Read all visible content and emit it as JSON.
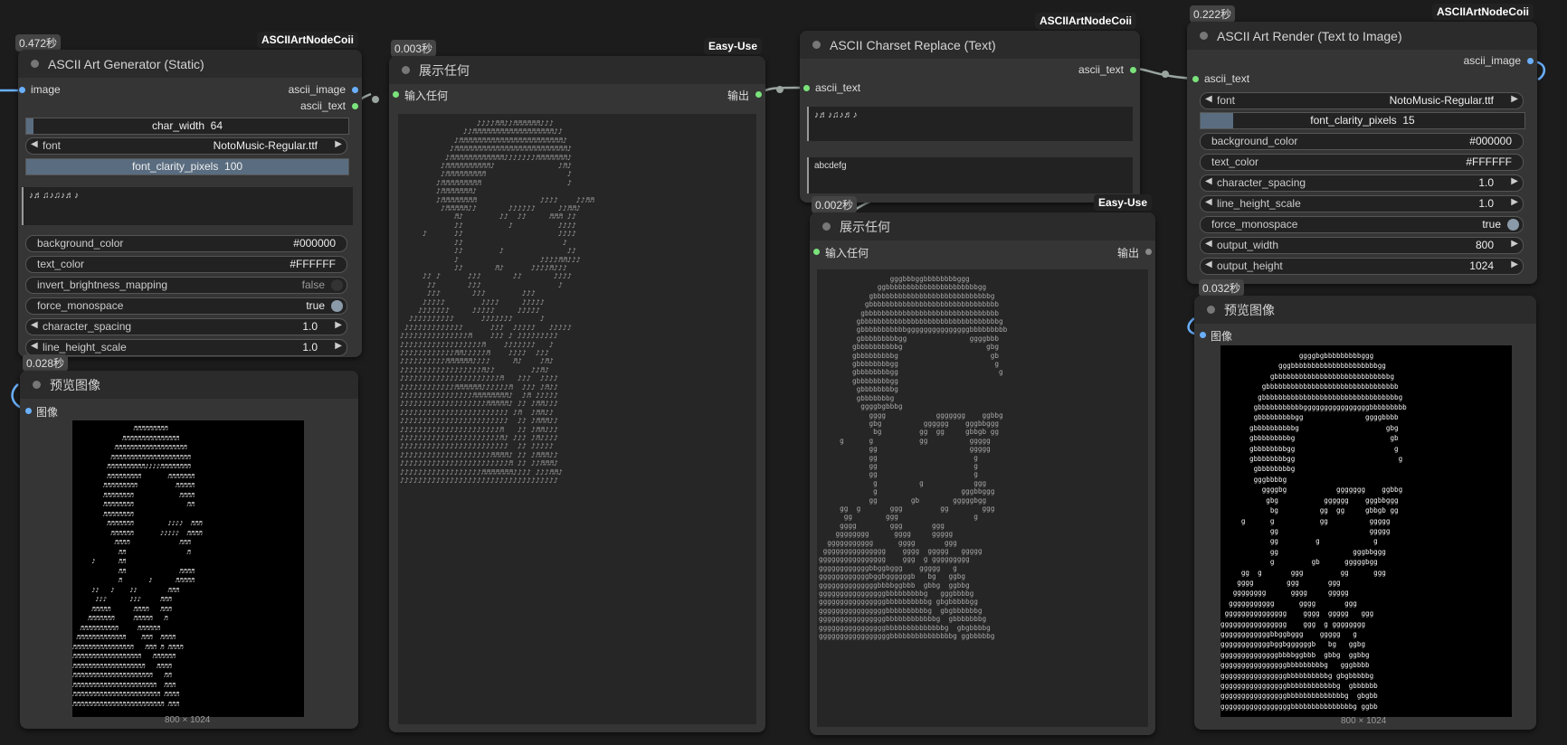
{
  "nodes": {
    "gen": {
      "time": "0.472秒",
      "badge": "ASCIIArtNodeCoii",
      "title": "ASCII Art Generator (Static)",
      "in_image": "image",
      "out_image": "ascii_image",
      "out_text": "ascii_text",
      "char_width_label": "char_width",
      "char_width_value": "64",
      "font_label": "font",
      "font_value": "NotoMusic-Regular.ttf",
      "clarity_label": "font_clarity_pixels",
      "clarity_value": "100",
      "charset": "♪♬♫♪♫♪♬♪",
      "bg_label": "background_color",
      "bg_value": "#000000",
      "text_color_label": "text_color",
      "text_color_value": "#FFFFFF",
      "invert_label": "invert_brightness_mapping",
      "invert_value": "false",
      "mono_label": "force_monospace",
      "mono_value": "true",
      "spacing_label": "character_spacing",
      "spacing_value": "1.0",
      "lh_label": "line_height_scale",
      "lh_value": "1.0"
    },
    "preview1": {
      "time": "0.028秒",
      "title": "预览图像",
      "in_label": "图像",
      "dim": "800 × 1024"
    },
    "show1": {
      "time": "0.003秒",
      "badge": "Easy-Use",
      "title": "展示任何",
      "in_label": "输入任何",
      "out_label": "输出"
    },
    "replace": {
      "badge": "ASCIIArtNodeCoii",
      "title": "ASCII Charset Replace (Text)",
      "out_text": "ascii_text",
      "in_text": "ascii_text",
      "from_chars": "♪♬♪♫♪♬♪",
      "to_chars": "abcdefg"
    },
    "show2": {
      "time": "0.002秒",
      "badge": "Easy-Use",
      "title": "展示任何",
      "in_label": "输入任何",
      "out_label": "输出"
    },
    "render": {
      "time": "0.222秒",
      "badge": "ASCIIArtNodeCoii",
      "title": "ASCII Art Render (Text to Image)",
      "out_image": "ascii_image",
      "in_text": "ascii_text",
      "font_label": "font",
      "font_value": "NotoMusic-Regular.ttf",
      "clarity_label": "font_clarity_pixels",
      "clarity_value": "15",
      "bg_label": "background_color",
      "bg_value": "#000000",
      "text_color_label": "text_color",
      "text_color_value": "#FFFFFF",
      "spacing_label": "character_spacing",
      "spacing_value": "1.0",
      "lh_label": "line_height_scale",
      "lh_value": "1.0",
      "mono_label": "force_monospace",
      "mono_value": "true",
      "ow_label": "output_width",
      "ow_value": "800",
      "oh_label": "output_height",
      "oh_value": "1024"
    },
    "preview2": {
      "time": "0.032秒",
      "title": "预览图像",
      "in_label": "图像",
      "dim": "800 × 1024"
    }
  },
  "colors": {
    "canvas": "#1c1c1c",
    "node": "#353535",
    "link": "#9aa5a0",
    "image_socket": "#6ab0ff",
    "any_socket": "#7be37b"
  },
  "ascii": {
    "notes": "                 ♪♪♪♪♬♬♪♪♬♬♬♬♬♬♪♪♪\n              ♪♪♬♬♬♬♬♬♬♬♬♬♬♬♬♬♬♬♬♬♪♪\n            ♪♬♬♬♬♬♬♬♬♬♬♬♬♬♬♬♬♬♬♬♬♬♬♬♪\n           ♪♬♬♬♬♬♬♬♬♬♬♬♬♬♬♬♬♬♬♬♬♬♬♬♬♬♪\n          ♪♬♬♬♬♬♬♬♬♬♬♬♬♪♪♪♪♪♪♪♬♬♬♬♬♬♬♪\n         ♪♬♬♬♬♬♬♬♬♬♬♪              ♪♬♪\n         ♪♬♬♬♬♬♬♬♬♬                  ♪\n        ♪♬♬♬♬♬♬♬♬♬                   ♪\n        ♪♬♬♬♬♬♬♬♪\n        ♪♬♬♬♬♬♬♬♬              ♪♪♪♪    ♪♪♬♬\n         ♪♬♬♬♬♬♪♪       ♪♪♪♪♪♪     ♪♪♬♬♪\n            ♬♪        ♪♪  ♪♪     ♬♬♬ ♪♪\n            ♪♪          ♪          ♪♪♪♪\n     ♪      ♪♪                     ♪♪♪♪\n            ♪♪                      ♪\n            ♪♪        ♪              ♪♪\n            ♪                  ♪♪♪♪♬♬♪♪♪\n            ♪♪       ♬♪      ♪♪♪♪♬♪♪♪\n     ♪♪ ♪      ♪♪♪       ♪♪       ♪♪♪♪\n      ♪♪       ♪♪♪                 ♪\n      ♪♪♪       ♪♪♪        ♪♪♪\n     ♪♪♪♪♪        ♪♪♪♪     ♪♪♪♪♪\n    ♪♪♪♪♪♪♪     ♪♪♪♪♪     ♪♪♪♪♪\n  ♪♪♪♪♪♪♪♪♪♪      ♪♪♪♪♪♪♪      ♪\n ♪♪♪♪♪♪♪♪♪♪♪♪♪      ♪♪♪  ♪♪♪♪♪   ♪♪♪♪♪\n♪♪♪♪♪♪♪♪♪♪♪♪♪♪♪♬    ♪♪♪ ♪ ♪♪♪♪♪♪♪♪♪\n♪♪♪♪♪♪♪♪♪♪♪♪♪♪♪♪♪♪♬    ♪♪♪♪♪♪♪   ♪\n♪♪♪♪♪♪♪♪♪♪♪♪♬♬♪♪♪♪♪♬    ♪♪♪♪  ♪♪♪\n♪♪♪♪♪♪♪♪♪♪♬♬♬♬♬♬♪♪♪♪     ♬♪    ♪♬♪\n♪♪♪♪♪♪♪♪♪♪♪♪♪♪♪♪♪♪♬♪♪        ♪♪♬♪\n♪♪♪♪♪♪♪♪♪♪♪♪♪♪♪♪♪♪♪♪♪♪♬   ♪♪♪  ♪♪♪♪\n♪♪♪♪♪♪♪♪♪♪♪♪♬♬♬♬♬♬♪♪♪♪♪♪♬  ♪♪♪ ♪♬♪♪\n♪♪♪♪♪♪♪♪♪♪♪♪♪♪♪♪♬♬♬♬♬♬♬♬♪  ♪♬ ♪♪♪♪♪\n♪♪♪♪♪♪♪♪♪♪♪♪♪♪♪♪♪♪♪♬♬♬♬♬♪ ♪♪ ♪♬♬♪♪♪\n♪♪♪♪♪♪♪♪♪♪♪♪♪♪♪♪♪♪♪♪♪♪♪♪ ♪♬  ♪♬♬♪♪\n♪♪♪♪♪♪♪♪♪♪♪♪♪♪♪♪♪♪♪♪♪♪♪♪  ♪♪ ♪♬♬♬♪♪\n♪♪♪♪♪♪♪♪♪♪♪♪♪♪♪♪♪♪♪♪♪♪♬   ♪♪ ♪♬♬♪♪♪\n♪♪♪♪♪♪♪♪♪♪♪♪♪♪♪♪♪♪♪♪♪♪♬♪ ♪♪♪ ♪♬♪♪♪♪\n♪♪♪♪♪♪♪♪♪♪♪♪♪♪♪♪♪♪♪♪♪♪♪♪  ♪♪ ♪♪♪♪♪\n♪♪♪♪♪♪♪♪♪♪♪♪♪♪♪♪♪♪♪♪♬♬♬♬♪ ♪♪ ♪♬♬♬♪♪\n♪♪♪♪♪♪♪♪♪♪♪♪♪♪♪♪♪♪♪♪♪♪♪♪♬ ♪♪ ♪♪♬♬♬♪\n♪♪♪♪♪♪♪♪♪♪♪♪♪♪♪♪♪♪♬♬♬♬♬♬♬♪♪♪♪ ♪♪♪♬♬♪\n♪♪♪♪♪♪♪♪♪♪♪♪♪♪♪♪♪♪♪♪♪♪♪♪♪♪♪♪♪♪♪♪♪♪♪",
    "letters": "                 gggbbbggbbbbbbbbggg\n              ggbbbbbbbbbbbbbbbbbbbbbbgg\n            gbbbbbbbbbbbbbbbbbbbbbbbbbbbbg\n           gbbbbbbbbbbbbbbbbbbbbbbbbbbbbbbb\n          gbbbbbbbbbbbbbbbbbbbbbbbbbbbbbbbb\n         gbbbbbbbbbbbbbbbbbbbbbbbbbbbbbbbbbg\n         gbbbbbbbbbbbgggggggggggggggbbbbbbbbb\n         gbbbbbbbbbgg               ggggbbb\n        gbbbbbbbbbbg                    gbg\n        gbbbbbbbbbg                      gb\n        gbbbbbbbbgg                       g\n        gbbbbbbbbgg                        g\n        gbbbbbbbbgg\n         gbbbbbbbbg\n         gbbbbbbbg\n          ggggbgbbbg\n            gggg            ggggggg    ggbbg\n            gbg          gggggg    gggbbggg\n             bg         gg  gg     gbbgb gg\n     g      g           gg          ggggg\n            gg                      ggggg\n            gg                       g\n            gg                       g\n            gg                       g\n             g          g            ggg\n             g                    gggbbggg\n            gg        gb        gggggbgg\n     gg  g       ggg         gg        ggg\n      gg        ggg                  g\n     gggg        ggg       ggg\n    gggggggg      gggg     ggggg\n  ggggggggggg      gggg       ggg\n ggggggggggggggg    gggg  ggggg   ggggg\ngggggggggggggggg    ggg  g ggggggggg\nggggggggggggbbggbggg    ggggg   g\nggggggggggggbggbggggggb   bg   ggbg\nggggggggggggggbbbbggbbb  gbbg  ggbbg\nggggggggggggggggbbbbbbbbbg   gggbbbbg\nggggggggggggggggbbbbbbbbbbg gbgbbbbbgg\nggggggggggggggggbbbbbbbbbbg  gbgbbbbbbg\nggggggggggggggggbbbbbbbbbbbbg  gbbbbbbbg\nggggggggggggggggbbbbbbbbbbbbbbg  gbgbbbbg\ngggggggggggggggggbbbbbbbbbbbbbbbg ggbbbbbg",
    "render": "                   ggggbgbbbbbbbbbggg\n              gggbbbbbbbbbbbbbbbbbbbbbgg\n            gbbbbbbbbbbbbbbbbbbbbbbbbbbbbg\n          gbbbbbbbbbbbbbbbbbbbbbbbbbbbbbbbb\n         gbbbbbbbbbbbbbbbbbbbbbbbbbbbbbbbbbg\n        gbbbbbbbbbbbggggggggggggggggbbbbbbbbb\n        gbbbbbbbbbgg               ggggbbbb\n       gbbbbbbbbbbg                     gbg\n       gbbbbbbbbbg                       gb\n       gbbbbbbbbgg                        g\n       gbbbbbbbbgg                         g\n        gbbbbbbbbg\n        gggbbbbg\n          ggggbg            ggggggg    ggbbg\n           gbg           gggggg    gggbbggg\n            bg          gg  gg     gbbgb gg\n     g      g           gg          ggggg\n            gg                      ggggg\n            gg         g             g\n            gg                  gggbbggg\n            g         gb      gggggbgg\n     gg  g       ggg         gg      ggg\n    gggg        ggg       ggg\n   gggggggg      gggg     ggggg\n  ggggggggggg      gggg       ggg\n ggggggggggggggg    gggg  ggggg   ggg\ngggggggggggggggg    ggg  g gggggggg\nggggggggggggbbggbggg    ggggg   g\nggggggggggggbggbggggggb   bg   ggbg\nggggggggggggggbbbbggbbb  gbbg  ggbbg\nggggggggggggggggbbbbbbbbbg   gggbbbb\nggggggggggggggggbbbbbbbbbbg gbgbbbbbg\nggggggggggggggggbbbbbbbbbbbbg  gbbbbbb\nggggggggggggggggbbbbbbbbbbbbbbg  gbgbb\ngggggggggggggggggbbbbbbbbbbbbbbbg ggbb",
    "gen_preview": "                ♬♬♬♬♬♬♬♬♬\n             ♬♬♬♬♬♬♬♬♬♬♬♬♬♬♬\n           ♬♬♬♬♬♬♬♬♬♬♬♬♬♬♬♬♬♬♬\n          ♬♬♬♬♬♬♬♬♬♬♬♬♬♬♬♬♬♬♬♬♬\n         ♬♬♬♬♬♬♬♬♬♬♪♪♪♪♬♬♬♬♬♬♬♬\n         ♬♬♬♬♬♬♬♬♬       ♬♬♬♬♬♬♬\n        ♬♬♬♬♬♬♬♬♬          ♬♬♬♬♬\n        ♬♬♬♬♬♬♬♬            ♬♬♬♬\n        ♬♬♬♬♬♬♬♬              ♬♬\n        ♬♬♬♬♬♬♬♬\n         ♬♬♬♬♬♬♬         ♪♪♪♪  ♬♬♬\n          ♬♬♬♬♬♬       ♪♪♪♪♪  ♬♬♬♬\n           ♬♬♬♬             ♬♬♬\n            ♬♬                ♬\n     ♪      ♬♬\n            ♬♬              ♬♬♬♬\n            ♬       ♪      ♬♬♬♬♬\n     ♪♪   ♪    ♪♪        ♬♬♬\n      ♪♪♪      ♪♪♪     ♬♬♬\n     ♬♬♬♬♬      ♬♬♬♬   ♬♬♬\n    ♬♬♬♬♬♬♬     ♬♬♬♬♬   ♬\n  ♬♬♬♬♬♬♬♬♬♬     ♬♬♬♬♬♬\n ♬♬♬♬♬♬♬♬♬♬♬♬♬    ♬♬♬  ♬♬♬♬\n♬♬♬♬♬♬♬♬♬♬♬♬♬♬♬♬   ♬♬♬ ♬ ♬♬♬♬\n♬♬♬♬♬♬♬♬♬♬♬♬♬♬♬♬♬♬   ♬♬♬♬♬♬\n♬♬♬♬♬♬♬♬♬♬♬♬♬♬♬♬♬♬♬   ♬♬♬♬\n♬♬♬♬♬♬♬♬♬♬♬♬♬♬♬♬♬♬♬♬♬   ♬♬\n♬♬♬♬♬♬♬♬♬♬♬♬♬♬♬♬♬♬♬♬♬♬  ♬♬♬\n♬♬♬♬♬♬♬♬♬♬♬♬♬♬♬♬♬♬♬♬♬♬♬ ♬♬♬♬\n♬♬♬♬♬♬♬♬♬♬♬♬♬♬♬♬♬♬♬♬♬♬♬♬ ♬♬♬"
  }
}
